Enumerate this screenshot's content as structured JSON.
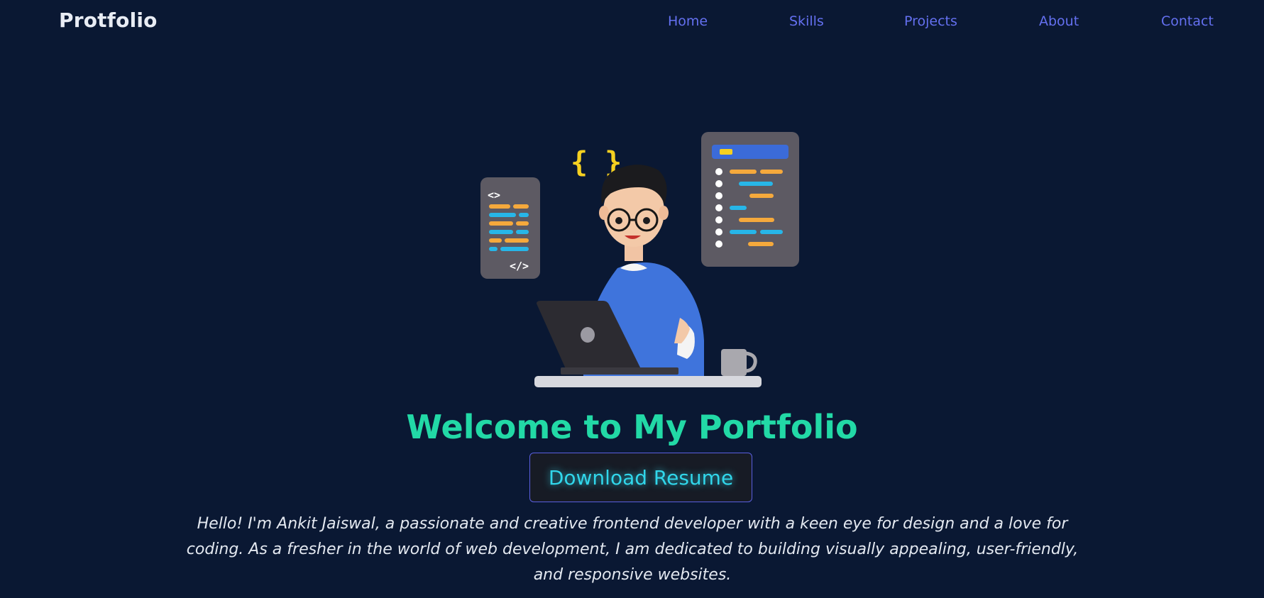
{
  "nav": {
    "logo": "Protfolio",
    "links": [
      "Home",
      "Skills",
      "Projects",
      "About",
      "Contact"
    ]
  },
  "hero": {
    "heading": "Welcome to My Portfolio",
    "button_label": "Download Resume",
    "intro": "Hello! I'm Ankit Jaiswal, a passionate and creative frontend developer with a keen eye for design and a love for coding. As a fresher in the world of web development, I am dedicated to building visually appealing, user-friendly, and responsive websites.",
    "illustration": {
      "brace_glyph": "{ }",
      "open_tag_glyph": "<>",
      "close_tag_glyph": "</>"
    }
  },
  "colors": {
    "background": "#0a1833",
    "nav_link": "#6470f0",
    "heading": "#22d9a6",
    "button_text": "#31d6ea",
    "button_border": "#5a5fe0",
    "intro_text": "#e3e8f0"
  }
}
